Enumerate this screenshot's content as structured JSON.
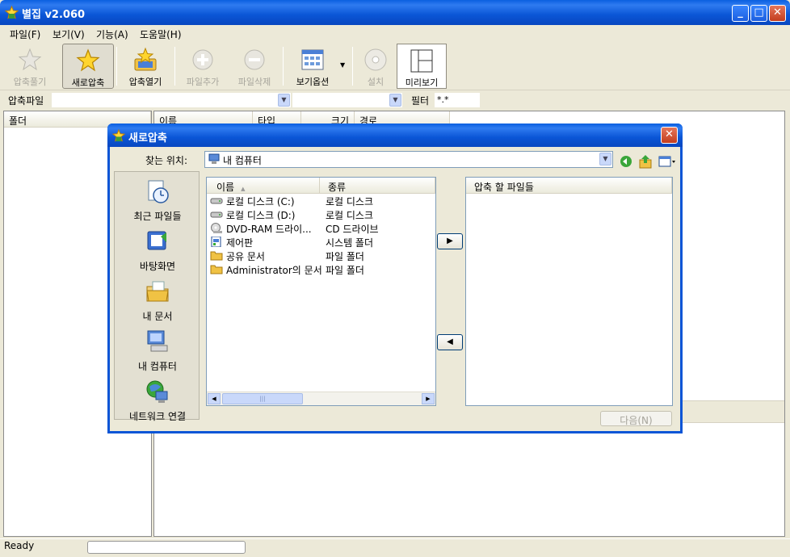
{
  "app": {
    "title": "별집 v2.060"
  },
  "menu": [
    "파일(F)",
    "보기(V)",
    "기능(A)",
    "도움말(H)"
  ],
  "toolbar": {
    "extract": "압축풀기",
    "new_archive": "새로압축",
    "open_archive": "압축열기",
    "add_file": "파일추가",
    "delete_file": "파일삭제",
    "view_options": "보기옵션",
    "install": "설치",
    "preview": "미리보기"
  },
  "address": {
    "label": "압축파일",
    "filter_label": "필터",
    "filter_value": "*.*"
  },
  "main": {
    "folder_header": "폴더",
    "columns": [
      "이름",
      "타입",
      "크기",
      "경로"
    ]
  },
  "status": {
    "text": "Ready"
  },
  "dialog": {
    "title": "새로압축",
    "location_label": "찾는 위치:",
    "location_value": "내 컴퓨터",
    "places": [
      "최근 파일들",
      "바탕화면",
      "내 문서",
      "내 컴퓨터",
      "네트워크 연결"
    ],
    "list_columns": [
      "이름",
      "종류"
    ],
    "items": [
      {
        "name": "로컬 디스크 (C:)",
        "type": "로컬 디스크",
        "icon": "drive-icon"
      },
      {
        "name": "로컬 디스크 (D:)",
        "type": "로컬 디스크",
        "icon": "drive-icon"
      },
      {
        "name": "DVD-RAM 드라이...",
        "type": "CD 드라이브",
        "icon": "dvd-icon"
      },
      {
        "name": "제어판",
        "type": "시스템 폴더",
        "icon": "control-panel-icon"
      },
      {
        "name": "공유 문서",
        "type": "파일 폴더",
        "icon": "folder-icon"
      },
      {
        "name": "Administrator의 문서",
        "type": "파일 폴더",
        "icon": "folder-icon"
      }
    ],
    "target_header": "압축 할 파일들",
    "next_button": "다음(N)",
    "scroll_grip": "|||"
  }
}
